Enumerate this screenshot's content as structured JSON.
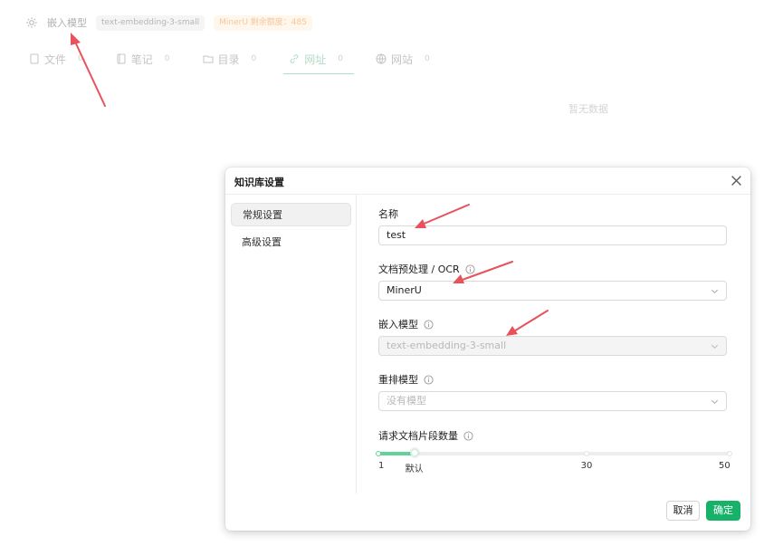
{
  "header": {
    "embedding_label": "嵌入模型",
    "model_chip": "text-embedding-3-small",
    "quota_chip": "MinerU 剩余额度：485"
  },
  "tabs": [
    {
      "label": "文件",
      "count": "0",
      "icon": "file-icon"
    },
    {
      "label": "笔记",
      "count": "0",
      "icon": "note-icon"
    },
    {
      "label": "目录",
      "count": "0",
      "icon": "folder-icon"
    },
    {
      "label": "网址",
      "count": "0",
      "icon": "link-icon"
    },
    {
      "label": "网站",
      "count": "0",
      "icon": "globe-icon"
    }
  ],
  "empty_text": "暂无数据",
  "modal": {
    "title": "知识库设置",
    "sidebar": [
      {
        "label": "常规设置"
      },
      {
        "label": "高级设置"
      }
    ],
    "fields": {
      "name": {
        "label": "名称",
        "value": "test"
      },
      "preprocess": {
        "label": "文档预处理 / OCR",
        "value": "MinerU"
      },
      "embedding": {
        "label": "嵌入模型",
        "value": "text-embedding-3-small"
      },
      "rerank": {
        "label": "重排模型",
        "placeholder": "没有模型"
      },
      "chunks": {
        "label": "请求文档片段数量",
        "value": 6,
        "min": 1,
        "max": 50,
        "marks": [
          {
            "value": 1,
            "label": "1"
          },
          {
            "value": 6,
            "label": "默认"
          },
          {
            "value": 30,
            "label": "30"
          },
          {
            "value": 50,
            "label": "50"
          }
        ]
      }
    },
    "buttons": {
      "cancel": "取消",
      "ok": "确定"
    }
  },
  "colors": {
    "accent": "#17b26a",
    "slider_fill": "#63d19a",
    "annotation_arrow": "#e8525a"
  }
}
